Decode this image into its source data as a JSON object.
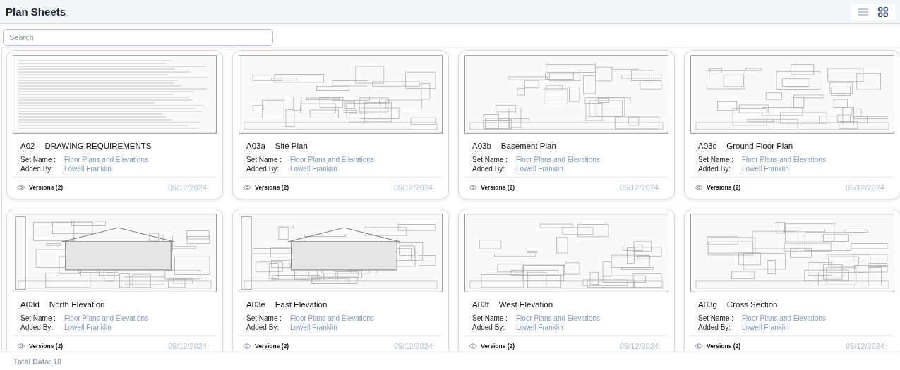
{
  "header": {
    "title": "Plan Sheets",
    "view_toggle": [
      {
        "kind": "list",
        "selected": false
      },
      {
        "kind": "grid",
        "selected": true
      }
    ]
  },
  "search": {
    "placeholder": "Search"
  },
  "sheets": [
    {
      "code": "A02",
      "name": "DRAWING REQUIREMENTS",
      "set_label": "Set Name :",
      "set_name": "Floor Plans and Elevations",
      "added_label": "Added By:",
      "added_by": "Lowell Franklin",
      "versions": "Versions (2)",
      "date": "05/12/2024"
    },
    {
      "code": "A03a",
      "name": "Site Plan",
      "set_label": "Set Name :",
      "set_name": "Floor Plans and Elevations",
      "added_label": "Added By:",
      "added_by": "Lowell Franklin",
      "versions": "Versions (2)",
      "date": "05/12/2024"
    },
    {
      "code": "A03b",
      "name": "Basement Plan",
      "set_label": "Set Name :",
      "set_name": "Floor Plans and Elevations",
      "added_label": "Added By:",
      "added_by": "Lowell Franklin",
      "versions": "Versions (2)",
      "date": "05/12/2024"
    },
    {
      "code": "A03c",
      "name": "Ground Floor Plan",
      "set_label": "Set Name :",
      "set_name": "Floor Plans and Elevations",
      "added_label": "Added By:",
      "added_by": "Lowell Franklin",
      "versions": "Versions (2)",
      "date": "05/12/2024"
    },
    {
      "code": "A03d",
      "name": "North Elevation",
      "set_label": "Set Name :",
      "set_name": "Floor Plans and Elevations",
      "added_label": "Added By:",
      "added_by": "Lowell Franklin",
      "versions": "Versions (2)",
      "date": "05/12/2024"
    },
    {
      "code": "A03e",
      "name": "East Elevation",
      "set_label": "Set Name :",
      "set_name": "Floor Plans and Elevations",
      "added_label": "Added By:",
      "added_by": "Lowell Franklin",
      "versions": "Versions (2)",
      "date": "05/12/2024"
    },
    {
      "code": "A03f",
      "name": "West Elevation",
      "set_label": "Set Name :",
      "set_name": "Floor Plans and Elevations",
      "added_label": "Added By:",
      "added_by": "Lowell Franklin",
      "versions": "Versions (2)",
      "date": "05/12/2024"
    },
    {
      "code": "A03g",
      "name": "Cross Section",
      "set_label": "Set Name :",
      "set_name": "Floor Plans and Elevations",
      "added_label": "Added By:",
      "added_by": "Lowell Franklin",
      "versions": "Versions (2)",
      "date": "05/12/2024"
    }
  ],
  "footer": {
    "total": "Total Data: 10"
  }
}
